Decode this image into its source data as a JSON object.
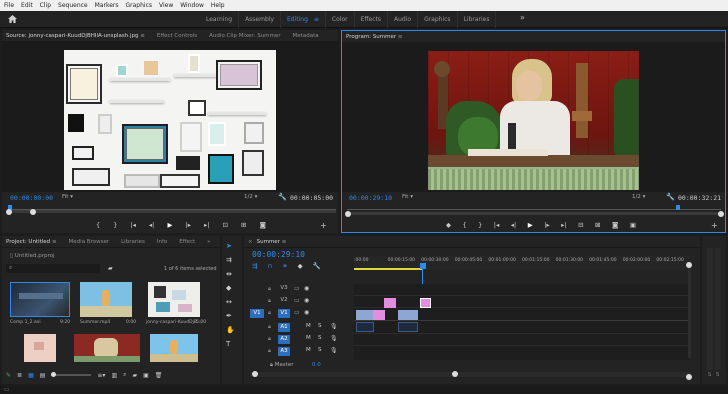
{
  "menu": [
    "File",
    "Edit",
    "Clip",
    "Sequence",
    "Markers",
    "Graphics",
    "View",
    "Window",
    "Help"
  ],
  "workspaces": {
    "tabs": [
      "Learning",
      "Assembly",
      "Editing",
      "Color",
      "Effects",
      "Audio",
      "Graphics",
      "Libraries"
    ],
    "active": "Editing",
    "more": "»",
    "menu_glyph": "≡"
  },
  "source_panel": {
    "tabs": [
      "Source: jonny-caspari-KuudDjBHIlA-unsplash.jpg",
      "Effect Controls",
      "Audio Clip Mixer: Summer",
      "Metadata"
    ],
    "tab_menu": "≡",
    "timecode_in": "00:00:00:00",
    "fit": "Fit",
    "scale": "1/2",
    "timecode_out": "00:00:05:00"
  },
  "program_panel": {
    "title": "Program: Summer",
    "tab_menu": "≡",
    "timecode_in": "00:00:29:10",
    "fit": "Fit",
    "scale": "1/2",
    "timecode_out": "00:00:32:21"
  },
  "project_panel": {
    "tabs": [
      "Project: Untitled",
      "Media Browser",
      "Libraries",
      "Info",
      "Effect"
    ],
    "tab_menu": "≡",
    "more": "»",
    "file": "Untitled.prproj",
    "count": "1 of 6 items selected",
    "items": [
      {
        "name": "Comp 1_2.avi",
        "duration": "9:20"
      },
      {
        "name": "Summer.mp4",
        "duration": "0:00"
      },
      {
        "name": "jonny-caspari-KuudDjB...",
        "duration": "5:00"
      },
      {
        "name": "",
        "duration": ""
      },
      {
        "name": "",
        "duration": ""
      },
      {
        "name": "",
        "duration": ""
      }
    ]
  },
  "timeline": {
    "sequence": "Summer",
    "tab_menu": "≡",
    "timecode": "00:00:29:10",
    "ruler": [
      ":00:00",
      "00:00:15:00",
      "00:00:30:00",
      "00:00:45:00",
      "00:01:00:00",
      "00:01:15:00",
      "00:01:30:00",
      "00:01:45:00",
      "00:02:00:00",
      "00:02:15:00"
    ],
    "video_tracks": [
      "V3",
      "V2",
      "V1"
    ],
    "audio_tracks": [
      "A1",
      "A2",
      "A3"
    ],
    "source_patch_v": "V1",
    "source_patch_a": "A1",
    "track_buttons": {
      "mute": "M",
      "solo": "S"
    },
    "master": "Master",
    "master_value": "0.0"
  },
  "meters": {
    "labels": [
      "S",
      "S"
    ]
  },
  "colors": {
    "accent": "#2d8ceb",
    "clip_pink": "#e28ee0",
    "clip_blue": "#8ea6d4",
    "bg": "#232323"
  }
}
